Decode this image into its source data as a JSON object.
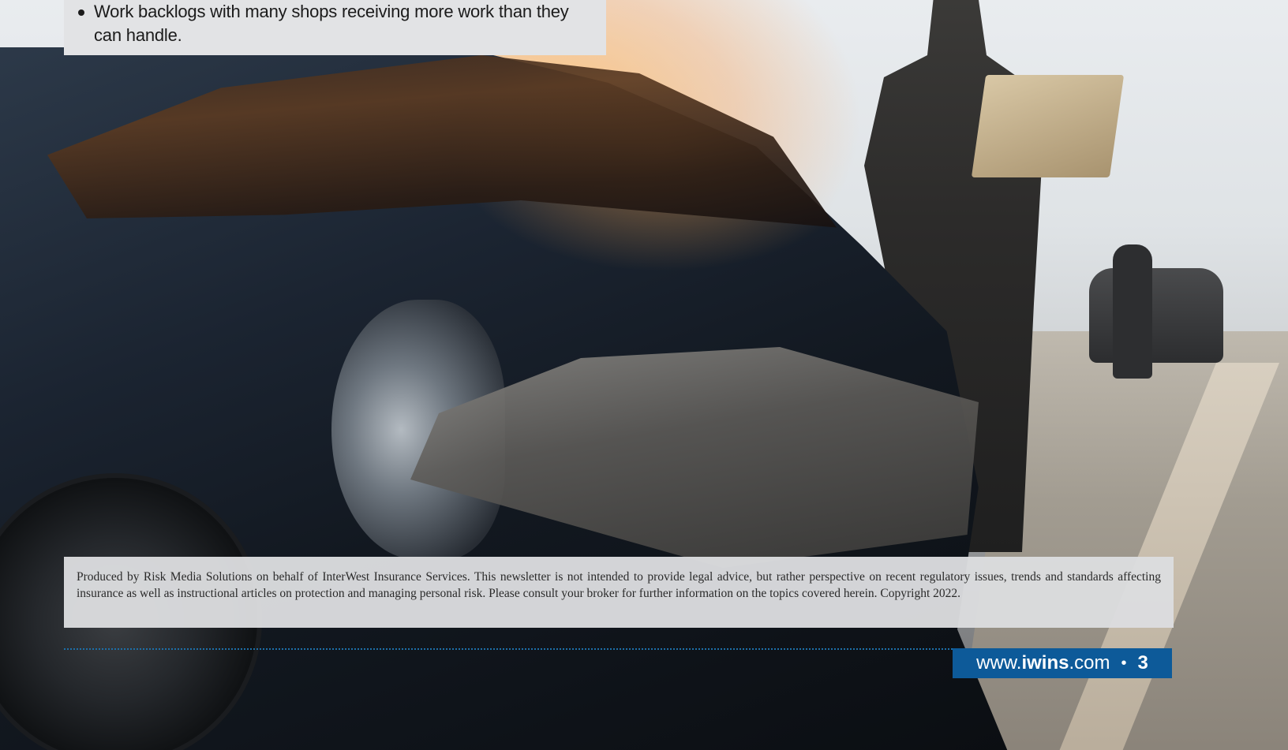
{
  "page": {
    "bullets": [
      "Work backlogs with many shops receiving more work than they can handle."
    ],
    "disclaimer": "Produced by Risk Media Solutions on behalf of InterWest Insurance Services. This newsletter is not intended to provide legal advice, but rather perspective on recent regulatory issues, trends and standards affecting insurance as well as instructional articles on protection and managing personal risk. Please consult your broker for further information on the topics covered herein. Copyright 2022.",
    "footer": {
      "url_prefix": "www.",
      "url_brand": "iwins",
      "url_suffix": ".com",
      "separator": "•",
      "page_number": "3"
    },
    "colors": {
      "footer_bg": "#0d5a99",
      "box_bg": "#e2e3e5",
      "rule": "#1d6fa8"
    }
  }
}
